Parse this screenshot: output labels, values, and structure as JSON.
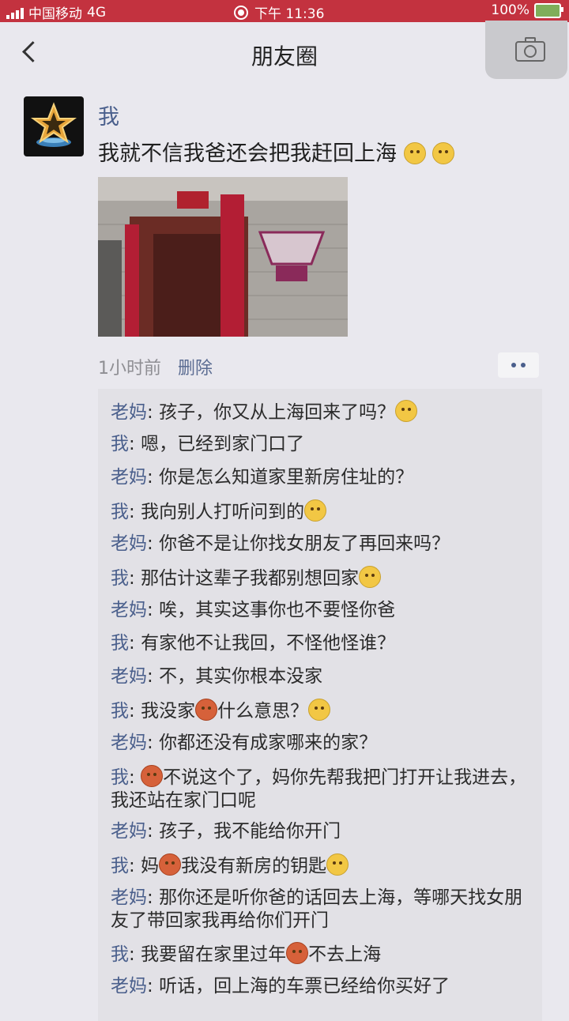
{
  "status_bar": {
    "carrier": "中国移动",
    "network": "4G",
    "time": "下午 11:36",
    "battery": "100%"
  },
  "nav": {
    "title": "朋友圈",
    "back_icon": "chevron-left-icon",
    "camera_icon": "camera-icon"
  },
  "post": {
    "username": "我",
    "text": "我就不信我爸还会把我赶回上海",
    "time_ago": "1小时前",
    "delete_label": "删除",
    "more_icon": "ellipsis-icon"
  },
  "comments": [
    {
      "name": "老妈",
      "text": "孩子，你又从上海回来了吗？",
      "emoji_after": 1
    },
    {
      "name": "我",
      "text": "嗯，已经到家门口了",
      "emoji_after": 0
    },
    {
      "name": "老妈",
      "text": "你是怎么知道家里新房住址的？",
      "emoji_after": 0
    },
    {
      "name": "我",
      "text": "我向别人打听问到的",
      "emoji_after": 1
    },
    {
      "name": "老妈",
      "text": "你爸不是让你找女朋友了再回来吗？",
      "emoji_after": 0
    },
    {
      "name": "我",
      "text": "那估计这辈子我都别想回家",
      "emoji_after": 1
    },
    {
      "name": "老妈",
      "text": "唉，其实这事你也不要怪你爸",
      "emoji_after": 0
    },
    {
      "name": "我",
      "text": "有家他不让我回，不怪他怪谁？",
      "emoji_after": 0
    },
    {
      "name": "老妈",
      "text": "不，其实你根本没家",
      "emoji_after": 0
    },
    {
      "name": "我",
      "text_a": "我没家",
      "text_b": "什么意思？",
      "emoji_after": 1
    },
    {
      "name": "老妈",
      "text": "你都还没有成家哪来的家？",
      "emoji_after": 0
    },
    {
      "name": "我",
      "text_b": "不说这个了，妈你先帮我把门打开让我进去，我还站在家门口呢",
      "emoji_after": 0
    },
    {
      "name": "老妈",
      "text": "孩子，我不能给你开门",
      "emoji_after": 0
    },
    {
      "name": "我",
      "text_a": "妈",
      "text_b": "我没有新房的钥匙",
      "emoji_after": 1
    },
    {
      "name": "老妈",
      "text": "那你还是听你爸的话回去上海，等哪天找女朋友了带回家我再给你们开门",
      "emoji_after": 0
    },
    {
      "name": "我",
      "text_a": "我要留在家里过年",
      "text_b": "不去上海",
      "emoji_after": 0
    },
    {
      "name": "老妈",
      "text": "听话，回上海的车票已经给你买好了",
      "emoji_after": 0
    }
  ],
  "colors": {
    "status_bar_bg": "#c3323f",
    "name_blue": "#4a5f8c",
    "page_bg": "#e9e8ee"
  }
}
